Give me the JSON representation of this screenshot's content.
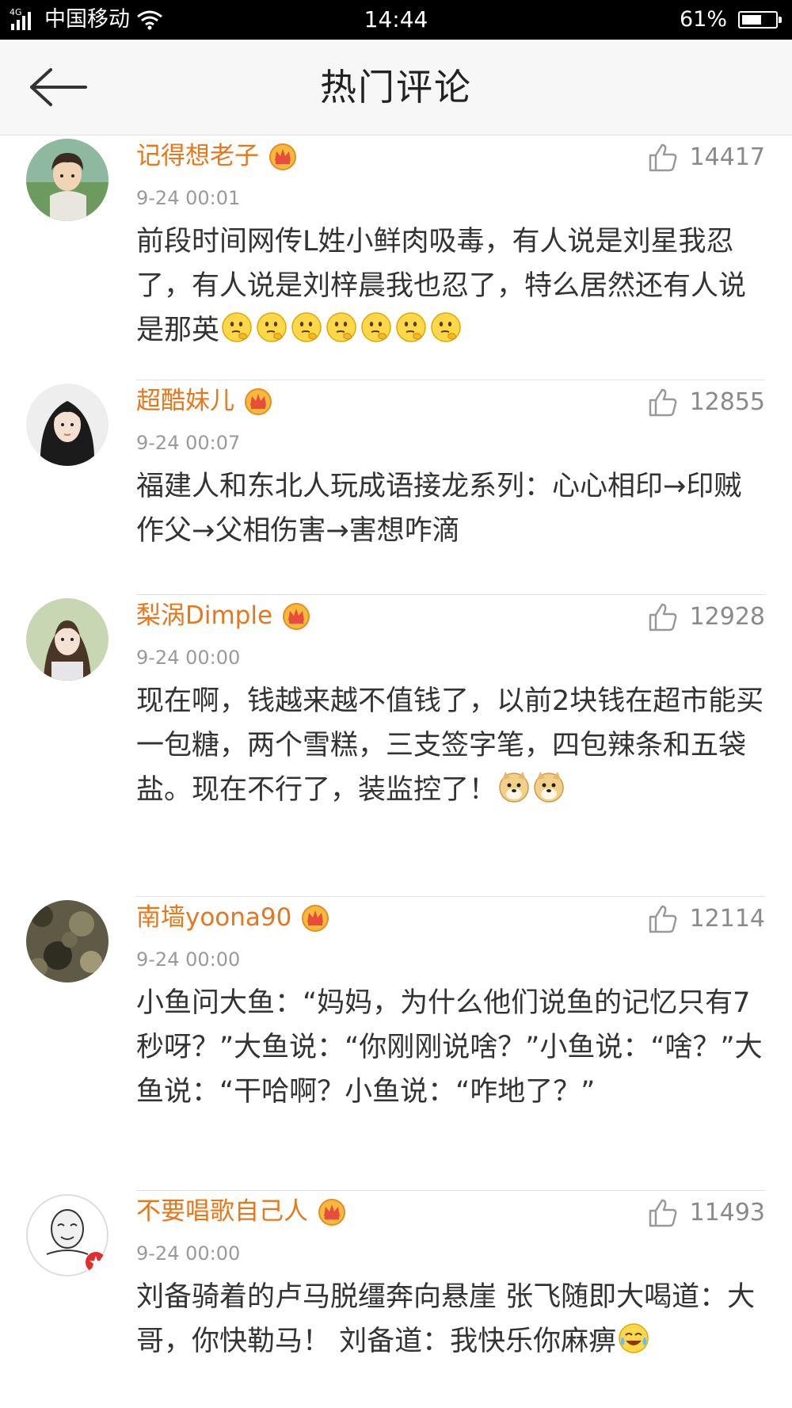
{
  "status_bar": {
    "network": "4G",
    "carrier": "中国移动",
    "time": "14:44",
    "battery_percent": "61%",
    "battery_level": 0.61
  },
  "header": {
    "title": "热门评论"
  },
  "comments": [
    {
      "author": "记得想老子",
      "likes": "14417",
      "time": "9-24 00:01",
      "text": "前段时间网传L姓小鲜肉吸毒，有人说是刘星我忍了，有人说是刘梓晨我也忍了，特么居然还有人说是那英",
      "emoji": "thinking-emoji",
      "emoji_count": 7
    },
    {
      "author": "超酷妹儿",
      "likes": "12855",
      "time": "9-24 00:07",
      "text": "福建人和东北人玩成语接龙系列：心心相印→印贼作父→父相伤害→害想咋滴",
      "emoji": "",
      "emoji_count": 0
    },
    {
      "author": "梨涡Dimple",
      "likes": "12928",
      "time": "9-24 00:00",
      "text": "现在啊，钱越来越不值钱了，以前2块钱在超市能买一包糖，两个雪糕，三支签字笔，四包辣条和五袋盐。现在不行了，装监控了！",
      "emoji": "doge-emoji",
      "emoji_count": 2
    },
    {
      "author": "南墙yoona90",
      "likes": "12114",
      "time": "9-24 00:00",
      "text": "小鱼问大鱼：“妈妈，为什么他们说鱼的记忆只有7秒呀？”大鱼说：“你刚刚说啥？”小鱼说：“啥？”大鱼说：“干哈啊？小鱼说：“咋地了？”",
      "emoji": "",
      "emoji_count": 0
    },
    {
      "author": "不要唱歌自己人",
      "likes": "11493",
      "time": "9-24 00:00",
      "text": "刘备骑着的卢马脱缰奔向悬崖 张飞随即大喝道：大哥，你快勒马！ 刘备道：我快乐你麻痹",
      "emoji": "laugh-cry-emoji",
      "emoji_count": 1
    }
  ]
}
